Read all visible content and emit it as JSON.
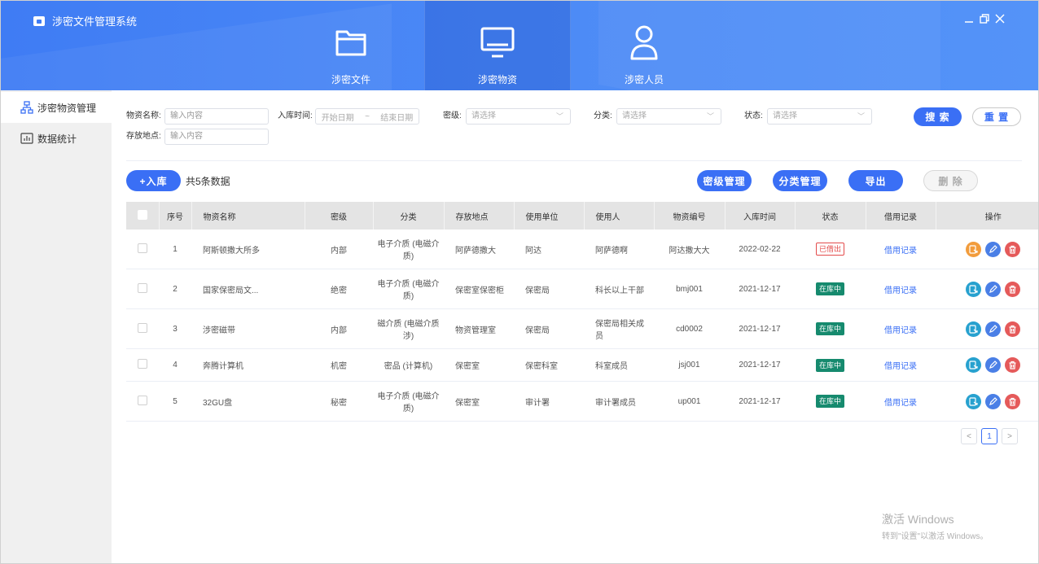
{
  "app": {
    "title": "涉密文件管理系统",
    "window_controls": [
      "minimize",
      "maximize",
      "close"
    ]
  },
  "nav": [
    {
      "label": "涉密文件",
      "icon": "folder-icon",
      "active": false
    },
    {
      "label": "涉密物资",
      "icon": "monitor-icon",
      "active": true
    },
    {
      "label": "涉密人员",
      "icon": "user-icon",
      "active": false
    }
  ],
  "sidebar": {
    "items": [
      {
        "label": "涉密物资管理",
        "icon": "sitemap-icon",
        "active": true
      },
      {
        "label": "数据统计",
        "icon": "chart-icon",
        "active": false
      }
    ]
  },
  "filters": {
    "name": {
      "label": "物资名称:",
      "placeholder": "输入内容"
    },
    "time": {
      "label": "入库时间:",
      "start_placeholder": "开始日期",
      "separator": "~",
      "end_placeholder": "结束日期"
    },
    "level": {
      "label": "密级:",
      "placeholder": "请选择"
    },
    "category": {
      "label": "分类:",
      "placeholder": "请选择"
    },
    "status": {
      "label": "状态:",
      "placeholder": "请选择"
    },
    "location": {
      "label": "存放地点:",
      "placeholder": "输入内容"
    },
    "search_label": "搜 索",
    "reset_label": "重 置"
  },
  "toolbar": {
    "add_label": "+入库",
    "count_text": "共5条数据",
    "level_mgmt_label": "密级管理",
    "category_mgmt_label": "分类管理",
    "export_label": "导出",
    "delete_label": "删 除"
  },
  "table": {
    "headers": [
      "序号",
      "物资名称",
      "密级",
      "分类",
      "存放地点",
      "使用单位",
      "使用人",
      "物资编号",
      "入库时间",
      "状态",
      "借用记录",
      "操作"
    ],
    "rows": [
      {
        "no": "1",
        "name": "阿斯顿撒大所多",
        "level": "内部",
        "category": "电子介质 (电磁介质)",
        "location": "阿萨德撒大",
        "unit": "阿达",
        "user": "阿萨德啊",
        "code": "阿达撒大大",
        "time": "2022-02-22",
        "status": "已借出",
        "status_type": "out",
        "record": "借用记录"
      },
      {
        "no": "2",
        "name": "国家保密局文...",
        "level": "绝密",
        "category": "电子介质 (电磁介质)",
        "location": "保密室保密柜",
        "unit": "保密局",
        "user": "科长以上干部",
        "code": "bmj001",
        "time": "2021-12-17",
        "status": "在库中",
        "status_type": "in",
        "record": "借用记录"
      },
      {
        "no": "3",
        "name": "涉密磁带",
        "level": "内部",
        "category": "磁介质 (电磁介质涉)",
        "location": "物资管理室",
        "unit": "保密局",
        "user": "保密局相关成员",
        "code": "cd0002",
        "time": "2021-12-17",
        "status": "在库中",
        "status_type": "in",
        "record": "借用记录"
      },
      {
        "no": "4",
        "name": "奔腾计算机",
        "level": "机密",
        "category": "密品 (计算机)",
        "location": "保密室",
        "unit": "保密科室",
        "user": "科室成员",
        "code": "jsj001",
        "time": "2021-12-17",
        "status": "在库中",
        "status_type": "in",
        "record": "借用记录"
      },
      {
        "no": "5",
        "name": "32GU盘",
        "level": "秘密",
        "category": "电子介质 (电磁介质)",
        "location": "保密室",
        "unit": "审计署",
        "user": "审计署成员",
        "code": "up001",
        "time": "2021-12-17",
        "status": "在库中",
        "status_type": "in",
        "record": "借用记录"
      }
    ]
  },
  "pagination": {
    "prev": "<",
    "current": "1",
    "next": ">"
  },
  "watermark": {
    "line1": "激活 Windows",
    "line2": "转到\"设置\"以激活 Windows。"
  },
  "colors": {
    "primary": "#3a6ff5",
    "header": "#4d8bf6",
    "status_out": "#e34b4b",
    "status_in": "#168a6e"
  }
}
